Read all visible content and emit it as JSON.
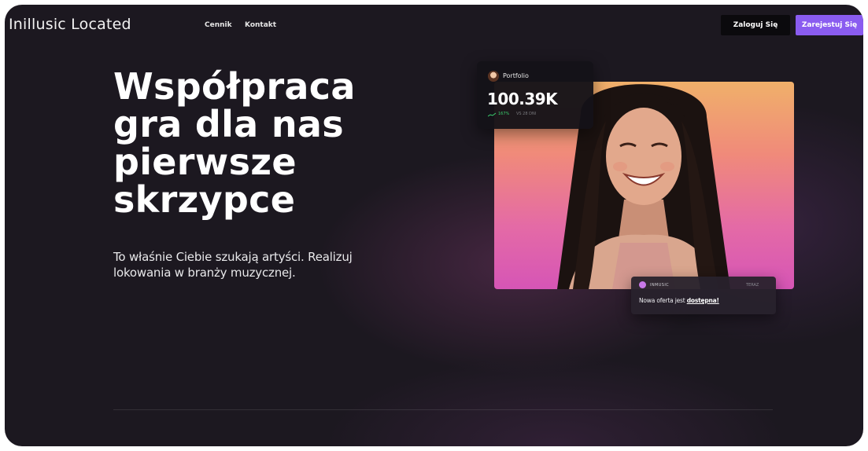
{
  "brand": {
    "logo_text": "Inillusic Located"
  },
  "nav": {
    "links": [
      {
        "label": "Cennik"
      },
      {
        "label": "Kontakt"
      }
    ],
    "login_label": "Zaloguj Się",
    "register_label": "Zarejestuj Się"
  },
  "hero": {
    "title_lines": [
      "Współpraca",
      "gra dla nas",
      "pierwsze",
      "skrzypce"
    ],
    "subtitle_lines": [
      "To właśnie Ciebie szukają artyści. Realizuj",
      "lokowania w branży muzycznej."
    ]
  },
  "portfolio_card": {
    "label": "Portfolio",
    "value": "100.39K",
    "change": "167%",
    "comparison": "VS 28 DNI"
  },
  "notification": {
    "brand": "INMUSIC",
    "time": "TERAZ",
    "text_prefix": "Nowa oferta jest ",
    "text_link": "dostępna!"
  },
  "colors": {
    "background": "#1c1820",
    "accent": "#8a5cf0",
    "positive": "#3bd16f"
  }
}
